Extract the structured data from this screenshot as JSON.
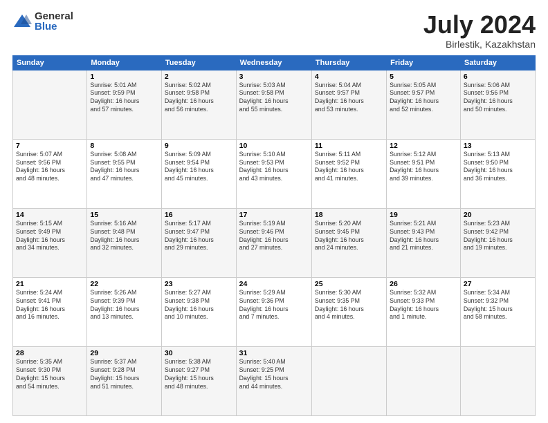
{
  "logo": {
    "general": "General",
    "blue": "Blue"
  },
  "title": {
    "month": "July 2024",
    "location": "Birlestik, Kazakhstan"
  },
  "weekdays": [
    "Sunday",
    "Monday",
    "Tuesday",
    "Wednesday",
    "Thursday",
    "Friday",
    "Saturday"
  ],
  "weeks": [
    [
      {
        "day": "",
        "info": ""
      },
      {
        "day": "1",
        "info": "Sunrise: 5:01 AM\nSunset: 9:59 PM\nDaylight: 16 hours\nand 57 minutes."
      },
      {
        "day": "2",
        "info": "Sunrise: 5:02 AM\nSunset: 9:58 PM\nDaylight: 16 hours\nand 56 minutes."
      },
      {
        "day": "3",
        "info": "Sunrise: 5:03 AM\nSunset: 9:58 PM\nDaylight: 16 hours\nand 55 minutes."
      },
      {
        "day": "4",
        "info": "Sunrise: 5:04 AM\nSunset: 9:57 PM\nDaylight: 16 hours\nand 53 minutes."
      },
      {
        "day": "5",
        "info": "Sunrise: 5:05 AM\nSunset: 9:57 PM\nDaylight: 16 hours\nand 52 minutes."
      },
      {
        "day": "6",
        "info": "Sunrise: 5:06 AM\nSunset: 9:56 PM\nDaylight: 16 hours\nand 50 minutes."
      }
    ],
    [
      {
        "day": "7",
        "info": "Sunrise: 5:07 AM\nSunset: 9:56 PM\nDaylight: 16 hours\nand 48 minutes."
      },
      {
        "day": "8",
        "info": "Sunrise: 5:08 AM\nSunset: 9:55 PM\nDaylight: 16 hours\nand 47 minutes."
      },
      {
        "day": "9",
        "info": "Sunrise: 5:09 AM\nSunset: 9:54 PM\nDaylight: 16 hours\nand 45 minutes."
      },
      {
        "day": "10",
        "info": "Sunrise: 5:10 AM\nSunset: 9:53 PM\nDaylight: 16 hours\nand 43 minutes."
      },
      {
        "day": "11",
        "info": "Sunrise: 5:11 AM\nSunset: 9:52 PM\nDaylight: 16 hours\nand 41 minutes."
      },
      {
        "day": "12",
        "info": "Sunrise: 5:12 AM\nSunset: 9:51 PM\nDaylight: 16 hours\nand 39 minutes."
      },
      {
        "day": "13",
        "info": "Sunrise: 5:13 AM\nSunset: 9:50 PM\nDaylight: 16 hours\nand 36 minutes."
      }
    ],
    [
      {
        "day": "14",
        "info": "Sunrise: 5:15 AM\nSunset: 9:49 PM\nDaylight: 16 hours\nand 34 minutes."
      },
      {
        "day": "15",
        "info": "Sunrise: 5:16 AM\nSunset: 9:48 PM\nDaylight: 16 hours\nand 32 minutes."
      },
      {
        "day": "16",
        "info": "Sunrise: 5:17 AM\nSunset: 9:47 PM\nDaylight: 16 hours\nand 29 minutes."
      },
      {
        "day": "17",
        "info": "Sunrise: 5:19 AM\nSunset: 9:46 PM\nDaylight: 16 hours\nand 27 minutes."
      },
      {
        "day": "18",
        "info": "Sunrise: 5:20 AM\nSunset: 9:45 PM\nDaylight: 16 hours\nand 24 minutes."
      },
      {
        "day": "19",
        "info": "Sunrise: 5:21 AM\nSunset: 9:43 PM\nDaylight: 16 hours\nand 21 minutes."
      },
      {
        "day": "20",
        "info": "Sunrise: 5:23 AM\nSunset: 9:42 PM\nDaylight: 16 hours\nand 19 minutes."
      }
    ],
    [
      {
        "day": "21",
        "info": "Sunrise: 5:24 AM\nSunset: 9:41 PM\nDaylight: 16 hours\nand 16 minutes."
      },
      {
        "day": "22",
        "info": "Sunrise: 5:26 AM\nSunset: 9:39 PM\nDaylight: 16 hours\nand 13 minutes."
      },
      {
        "day": "23",
        "info": "Sunrise: 5:27 AM\nSunset: 9:38 PM\nDaylight: 16 hours\nand 10 minutes."
      },
      {
        "day": "24",
        "info": "Sunrise: 5:29 AM\nSunset: 9:36 PM\nDaylight: 16 hours\nand 7 minutes."
      },
      {
        "day": "25",
        "info": "Sunrise: 5:30 AM\nSunset: 9:35 PM\nDaylight: 16 hours\nand 4 minutes."
      },
      {
        "day": "26",
        "info": "Sunrise: 5:32 AM\nSunset: 9:33 PM\nDaylight: 16 hours\nand 1 minute."
      },
      {
        "day": "27",
        "info": "Sunrise: 5:34 AM\nSunset: 9:32 PM\nDaylight: 15 hours\nand 58 minutes."
      }
    ],
    [
      {
        "day": "28",
        "info": "Sunrise: 5:35 AM\nSunset: 9:30 PM\nDaylight: 15 hours\nand 54 minutes."
      },
      {
        "day": "29",
        "info": "Sunrise: 5:37 AM\nSunset: 9:28 PM\nDaylight: 15 hours\nand 51 minutes."
      },
      {
        "day": "30",
        "info": "Sunrise: 5:38 AM\nSunset: 9:27 PM\nDaylight: 15 hours\nand 48 minutes."
      },
      {
        "day": "31",
        "info": "Sunrise: 5:40 AM\nSunset: 9:25 PM\nDaylight: 15 hours\nand 44 minutes."
      },
      {
        "day": "",
        "info": ""
      },
      {
        "day": "",
        "info": ""
      },
      {
        "day": "",
        "info": ""
      }
    ]
  ]
}
